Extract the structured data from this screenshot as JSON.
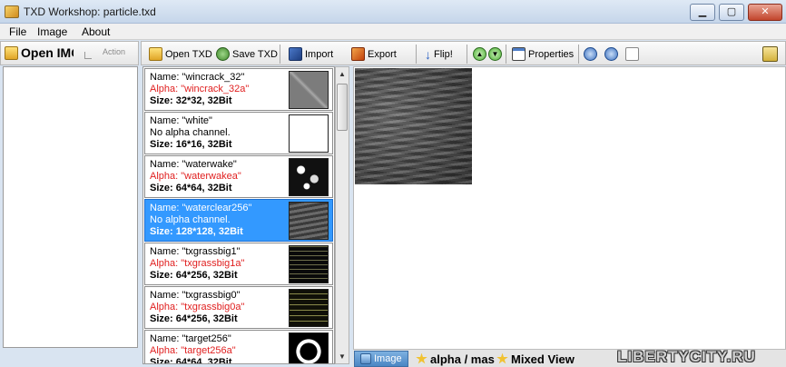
{
  "window": {
    "title": "TXD Workshop: particle.txd"
  },
  "titlebar": {
    "min_label": "▁",
    "max_label": "▢",
    "close_label": "✕"
  },
  "menu": [
    "File",
    "Image",
    "About"
  ],
  "left_toolbar": {
    "open_label": "Open IMG",
    "action_label": "Action"
  },
  "toolbar": {
    "open_txd": "Open TXD",
    "save_txd": "Save TXD",
    "import": "Import",
    "export": "Export",
    "flip": "Flip!",
    "properties": "Properties"
  },
  "textures": [
    {
      "name": "Name: \"wincrack_32\"",
      "alpha": "Alpha: \"wincrack_32a\"",
      "size": "Size: 32*32, 32Bit",
      "has_alpha": true,
      "thumb": "#8d8d8d"
    },
    {
      "name": "Name: \"white\"",
      "alpha": "No alpha channel.",
      "size": "Size: 16*16, 32Bit",
      "has_alpha": false,
      "thumb": "#ffffff"
    },
    {
      "name": "Name: \"waterwake\"",
      "alpha": "Alpha: \"waterwakea\"",
      "size": "Size: 64*64, 32Bit",
      "has_alpha": true,
      "thumb": "#1a1a1a"
    },
    {
      "name": "Name: \"waterclear256\"",
      "alpha": "No alpha channel.",
      "size": "Size: 128*128, 32Bit",
      "has_alpha": false,
      "thumb": "#4e4e4e",
      "selected": true
    },
    {
      "name": "Name: \"txgrassbig1\"",
      "alpha": "Alpha: \"txgrassbig1a\"",
      "size": "Size: 64*256, 32Bit",
      "has_alpha": true,
      "thumb": "#0d0d0d"
    },
    {
      "name": "Name: \"txgrassbig0\"",
      "alpha": "Alpha: \"txgrassbig0a\"",
      "size": "Size: 64*256, 32Bit",
      "has_alpha": true,
      "thumb": "#121208"
    },
    {
      "name": "Name: \"target256\"",
      "alpha": "Alpha: \"target256a\"",
      "size": "Size: 64*64, 32Bit",
      "has_alpha": true,
      "thumb": "#000000"
    }
  ],
  "tabs": {
    "image": "Image",
    "alpha": "alpha / mas",
    "mixed": "Mixed View"
  },
  "watermark": "LIBERTYCITY.RU",
  "colors": {
    "selected": "#3399ff",
    "alpha_text": "#e02020"
  }
}
